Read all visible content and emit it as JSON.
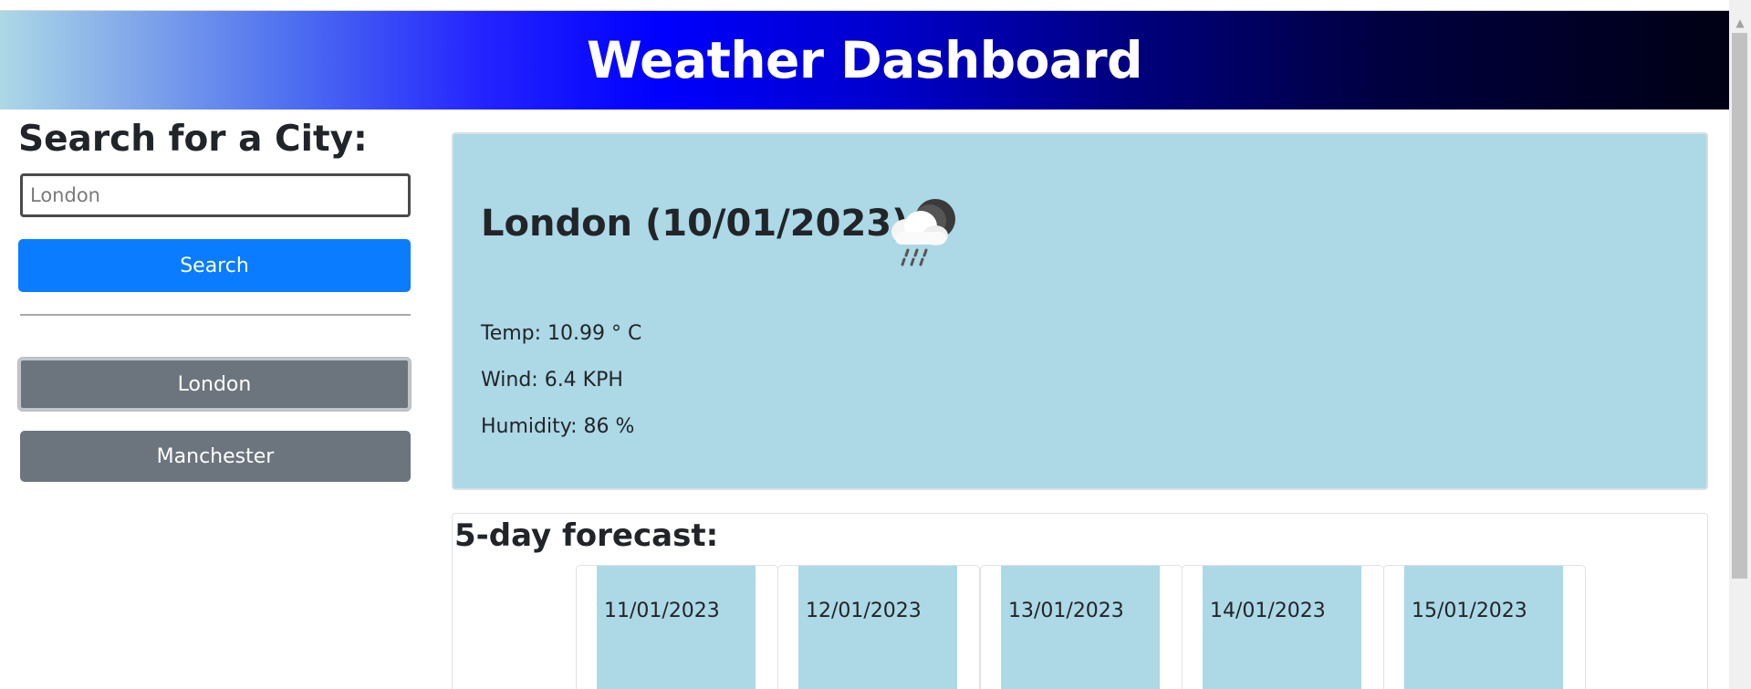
{
  "header": {
    "title": "Weather Dashboard"
  },
  "sidebar": {
    "heading": "Search for a City:",
    "search_placeholder": "London",
    "search_button": "Search",
    "history": [
      {
        "label": "London",
        "active": true
      },
      {
        "label": "Manchester",
        "active": false
      }
    ]
  },
  "current": {
    "title": "London (10/01/2023)",
    "icon": "rain-cloud-night-icon",
    "temp": "Temp: 10.99 ° C",
    "wind": "Wind: 6.4 KPH",
    "humidity": "Humidity: 86 %"
  },
  "forecast": {
    "heading": "5-day forecast:",
    "days": [
      {
        "date": "11/01/2023"
      },
      {
        "date": "12/01/2023"
      },
      {
        "date": "13/01/2023"
      },
      {
        "date": "14/01/2023"
      },
      {
        "date": "15/01/2023"
      }
    ]
  },
  "colors": {
    "accent": "#0a7cff",
    "card": "#add8e6",
    "history_button": "#6c757d"
  }
}
